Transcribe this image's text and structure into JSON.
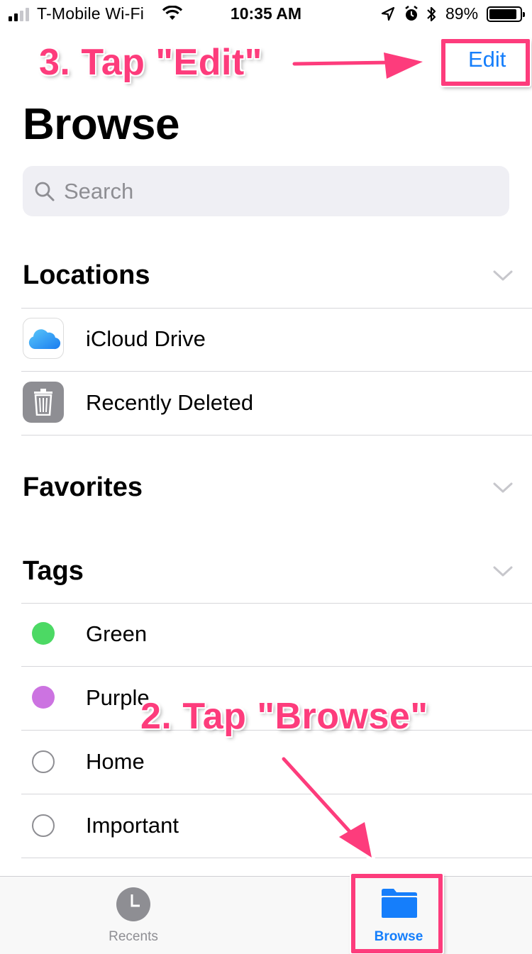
{
  "status_bar": {
    "carrier": "T-Mobile Wi-Fi",
    "time": "10:35 AM",
    "battery_percent": "89%",
    "battery_level": 0.89
  },
  "nav": {
    "edit_label": "Edit",
    "title": "Browse"
  },
  "search": {
    "placeholder": "Search"
  },
  "sections": {
    "locations": {
      "header": "Locations",
      "items": [
        {
          "label": "iCloud Drive",
          "icon": "icloud-drive-icon"
        },
        {
          "label": "Recently Deleted",
          "icon": "trash-icon"
        }
      ]
    },
    "favorites": {
      "header": "Favorites"
    },
    "tags": {
      "header": "Tags",
      "items": [
        {
          "label": "Green",
          "color": "#4cd964"
        },
        {
          "label": "Purple",
          "color": "#cc73e1"
        },
        {
          "label": "Home",
          "color": ""
        },
        {
          "label": "Important",
          "color": ""
        }
      ]
    }
  },
  "tab_bar": {
    "recents_label": "Recents",
    "browse_label": "Browse",
    "active_tab": "Browse"
  },
  "annotations": {
    "step3": "3. Tap \"Edit\"",
    "step2": "2. Tap \"Browse\"",
    "color": "#fd3c7c"
  },
  "colors": {
    "accent": "#157efb",
    "separator": "#d6d6da",
    "secondary_text": "#8e8e93"
  }
}
